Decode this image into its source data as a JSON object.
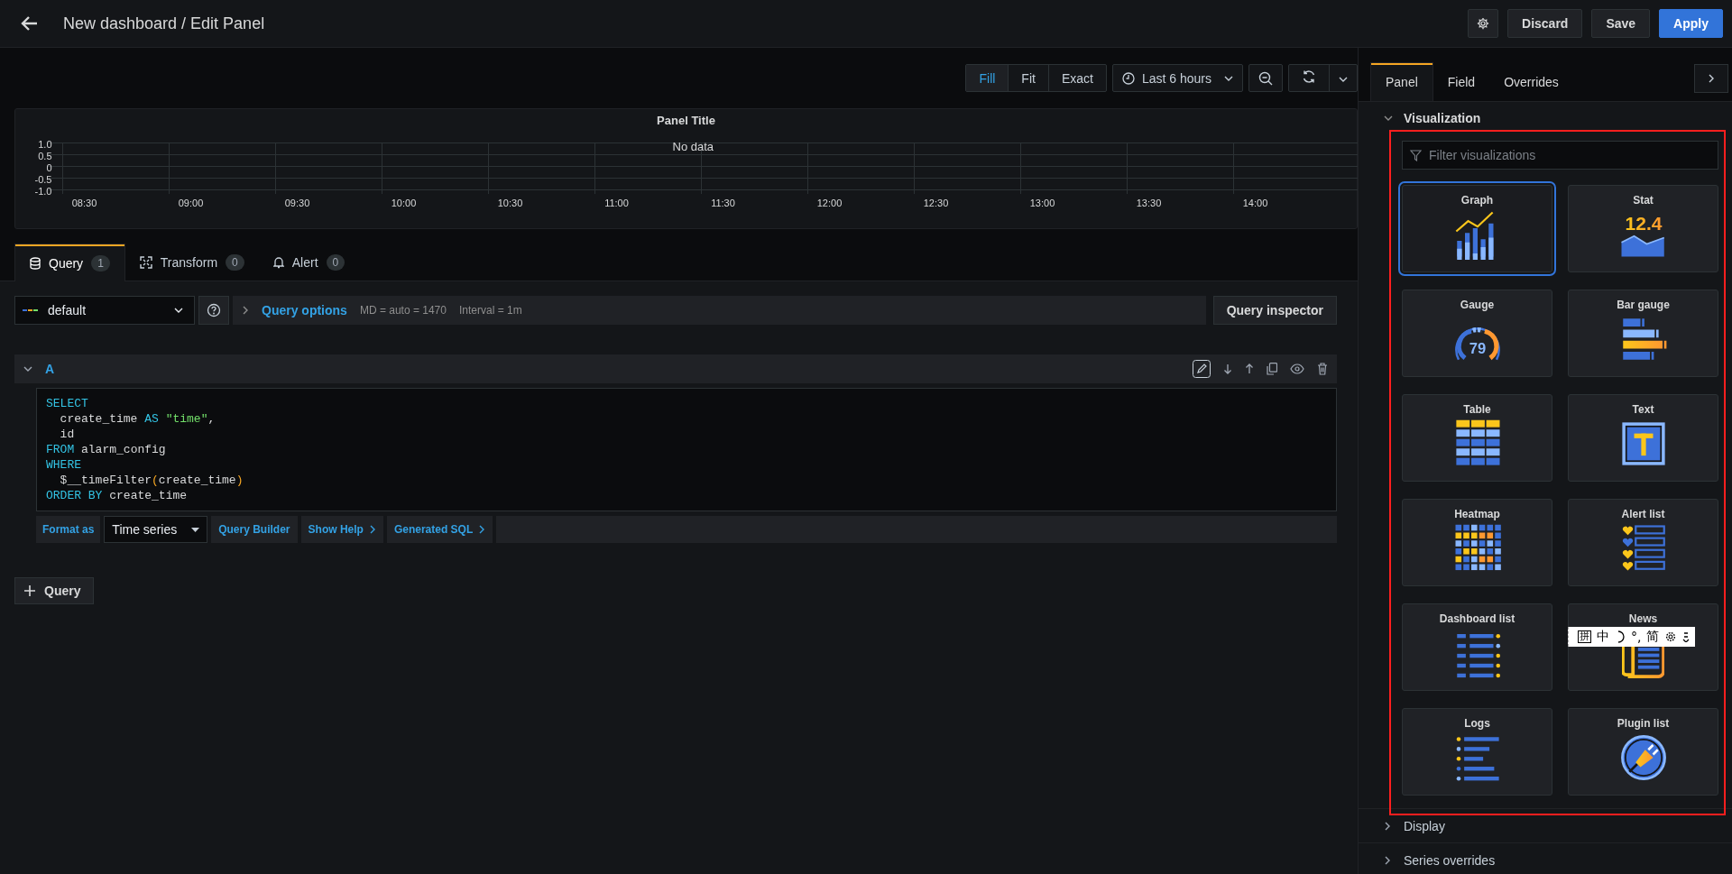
{
  "header": {
    "title": "New dashboard / Edit Panel",
    "buttons": [
      {
        "label": "Discard",
        "kind": "secondary"
      },
      {
        "label": "Save",
        "kind": "secondary"
      },
      {
        "label": "Apply",
        "kind": "primary"
      }
    ]
  },
  "view_modes": [
    {
      "label": "Fill",
      "selected": true
    },
    {
      "label": "Fit",
      "selected": false
    },
    {
      "label": "Exact",
      "selected": false
    }
  ],
  "time_range": "Last 6 hours",
  "panel": {
    "title": "Panel Title",
    "message": "No data",
    "y_labels": [
      "1.0",
      "0.5",
      "0",
      "-0.5",
      "-1.0"
    ],
    "x_labels": [
      "08:30",
      "09:00",
      "09:30",
      "10:00",
      "10:30",
      "11:00",
      "11:30",
      "12:00",
      "12:30",
      "13:00",
      "13:30",
      "14:00"
    ]
  },
  "query_tabs": [
    {
      "label": "Query",
      "count": "1",
      "kind": "database",
      "selected": true
    },
    {
      "label": "Transform",
      "count": "0",
      "kind": "transform",
      "selected": false
    },
    {
      "label": "Alert",
      "count": "0",
      "kind": "bell",
      "selected": false
    }
  ],
  "data_source": "default",
  "query_options": {
    "label": "Query options",
    "md": "MD = auto = 1470",
    "interval": "Interval = 1m"
  },
  "query_inspector": "Query inspector",
  "query": {
    "ref": "A",
    "expanded": true,
    "sql": [
      [
        {
          "text": "SELECT",
          "kind": "keyword"
        }
      ],
      [
        {
          "text": "  create_time ",
          "kind": "plain"
        },
        {
          "text": "AS",
          "kind": "keyword"
        },
        {
          "text": " \"time\"",
          "kind": "string"
        },
        {
          "text": ",",
          "kind": "plain"
        }
      ],
      [
        {
          "text": "  id",
          "kind": "plain"
        }
      ],
      [
        {
          "text": "FROM",
          "kind": "keyword"
        },
        {
          "text": " alarm_config",
          "kind": "plain"
        }
      ],
      [
        {
          "text": "WHERE",
          "kind": "keyword"
        }
      ],
      [
        {
          "text": "  $__timeFilter",
          "kind": "plain"
        },
        {
          "text": "(",
          "kind": "paren"
        },
        {
          "text": "create_time",
          "kind": "plain"
        },
        {
          "text": ")",
          "kind": "paren"
        }
      ],
      [
        {
          "text": "ORDER BY",
          "kind": "keyword"
        },
        {
          "text": " create_time",
          "kind": "plain"
        }
      ]
    ]
  },
  "format_bar": {
    "label": "Format as",
    "format": "Time series",
    "links": [
      {
        "label": "Query Builder",
        "chevron": false
      },
      {
        "label": "Show Help",
        "chevron": true
      },
      {
        "label": "Generated SQL",
        "chevron": true
      }
    ]
  },
  "add_query": "Query",
  "options": {
    "tabs": [
      {
        "label": "Panel",
        "selected": true
      },
      {
        "label": "Field",
        "selected": false
      },
      {
        "label": "Overrides",
        "selected": false
      }
    ],
    "section": "Visualization",
    "section_expanded": true,
    "filter_placeholder": "Filter visualizations",
    "visualizations": [
      {
        "name": "Graph",
        "kind": "graph",
        "selected": true
      },
      {
        "name": "Stat",
        "kind": "stat",
        "icon_text": "12.4",
        "selected": false
      },
      {
        "name": "Gauge",
        "kind": "gauge",
        "icon_text": "79",
        "selected": false
      },
      {
        "name": "Bar gauge",
        "kind": "bargauge",
        "selected": false
      },
      {
        "name": "Table",
        "kind": "table",
        "selected": false
      },
      {
        "name": "Text",
        "kind": "text",
        "selected": false
      },
      {
        "name": "Heatmap",
        "kind": "heatmap",
        "selected": false
      },
      {
        "name": "Alert list",
        "kind": "alertlist",
        "selected": false
      },
      {
        "name": "Dashboard list",
        "kind": "dashlist",
        "selected": false
      },
      {
        "name": "News",
        "kind": "news",
        "selected": false
      },
      {
        "name": "Logs",
        "kind": "logs",
        "selected": false
      },
      {
        "name": "Plugin list",
        "kind": "pluginlist",
        "selected": false
      }
    ],
    "collapsed_sections": [
      "Display",
      "Series overrides"
    ]
  },
  "ime_toolbar": [
    {
      "kind": "boxed",
      "text": "拼"
    },
    {
      "kind": "text",
      "text": "中"
    },
    {
      "kind": "moon"
    },
    {
      "kind": "text",
      "text": "°,"
    },
    {
      "kind": "text",
      "text": "简"
    },
    {
      "kind": "gear"
    },
    {
      "kind": "more"
    }
  ]
}
